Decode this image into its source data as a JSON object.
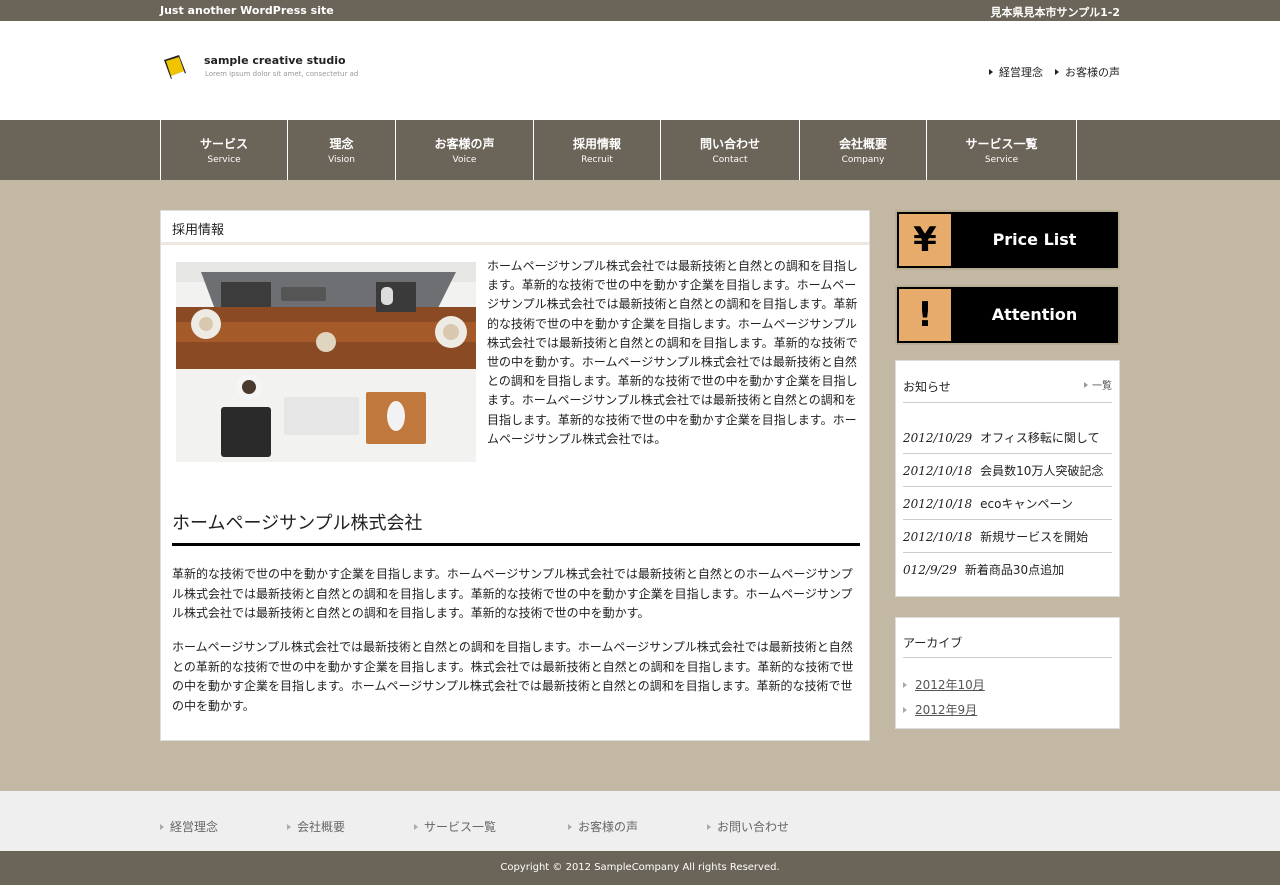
{
  "topbar": {
    "tagline": "Just another WordPress site",
    "address": "見本県見本市サンプル1-2"
  },
  "header": {
    "site_name": "sample creative studio",
    "site_sub": "Lorem ipsum dolor sit amet, consectetur ad",
    "links": [
      "経営理念",
      "お客様の声"
    ]
  },
  "gnav": [
    {
      "ja": "サービス",
      "en": "Service"
    },
    {
      "ja": "理念",
      "en": "Vision"
    },
    {
      "ja": "お客様の声",
      "en": "Voice"
    },
    {
      "ja": "採用情報",
      "en": "Recruit"
    },
    {
      "ja": "問い合わせ",
      "en": "Contact"
    },
    {
      "ja": "会社概要",
      "en": "Company"
    },
    {
      "ja": "サービス一覧",
      "en": "Service"
    }
  ],
  "main": {
    "title": "採用情報",
    "intro": "ホームページサンプル株式会社では最新技術と自然との調和を目指します。革新的な技術で世の中を動かす企業を目指します。ホームページサンプル株式会社では最新技術と自然との調和を目指します。革新的な技術で世の中を動かす企業を目指します。ホームページサンプル株式会社では最新技術と自然との調和を目指します。革新的な技術で世の中を動かす。ホームページサンプル株式会社では最新技術と自然との調和を目指します。革新的な技術で世の中を動かす企業を目指します。ホームページサンプル株式会社では最新技術と自然との調和を目指します。革新的な技術で世の中を動かす企業を目指します。ホームページサンプル株式会社では。",
    "heading": "ホームページサンプル株式会社",
    "para1": "革新的な技術で世の中を動かす企業を目指します。ホームページサンプル株式会社では最新技術と自然とのホームページサンプル株式会社では最新技術と自然との調和を目指します。革新的な技術で世の中を動かす企業を目指します。ホームページサンプル株式会社では最新技術と自然との調和を目指します。革新的な技術で世の中を動かす。",
    "para2": "ホームページサンプル株式会社では最新技術と自然との調和を目指します。ホームページサンプル株式会社では最新技術と自然との革新的な技術で世の中を動かす企業を目指します。株式会社では最新技術と自然との調和を目指します。革新的な技術で世の中を動かす企業を目指します。ホームページサンプル株式会社では最新技術と自然との調和を目指します。革新的な技術で世の中を動かす。"
  },
  "sidebar": {
    "banners": [
      {
        "icon": "¥",
        "label": "Price List"
      },
      {
        "icon": "!",
        "label": "Attention"
      }
    ],
    "news": {
      "title": "お知らせ",
      "more": "一覧",
      "items": [
        {
          "date": "2012/10/29",
          "text": "オフィス移転に関して"
        },
        {
          "date": "2012/10/18",
          "text": "会員数10万人突破記念"
        },
        {
          "date": "2012/10/18",
          "text": "ecoキャンペーン"
        },
        {
          "date": "2012/10/18",
          "text": "新規サービスを開始"
        },
        {
          "date": "012/9/29",
          "text": "新着商品30点追加"
        }
      ]
    },
    "archive": {
      "title": "アーカイブ",
      "items": [
        "2012年10月",
        "2012年9月"
      ]
    }
  },
  "footer": {
    "links": [
      "経営理念",
      "会社概要",
      "サービス一覧",
      "お客様の声",
      "お問い合わせ"
    ],
    "copyright": "Copyright © 2012 SampleCompany All rights Reserved."
  },
  "colors": {
    "bar": "#6b6458",
    "background": "#c2b8a3",
    "accent": "#e7ac6b"
  }
}
